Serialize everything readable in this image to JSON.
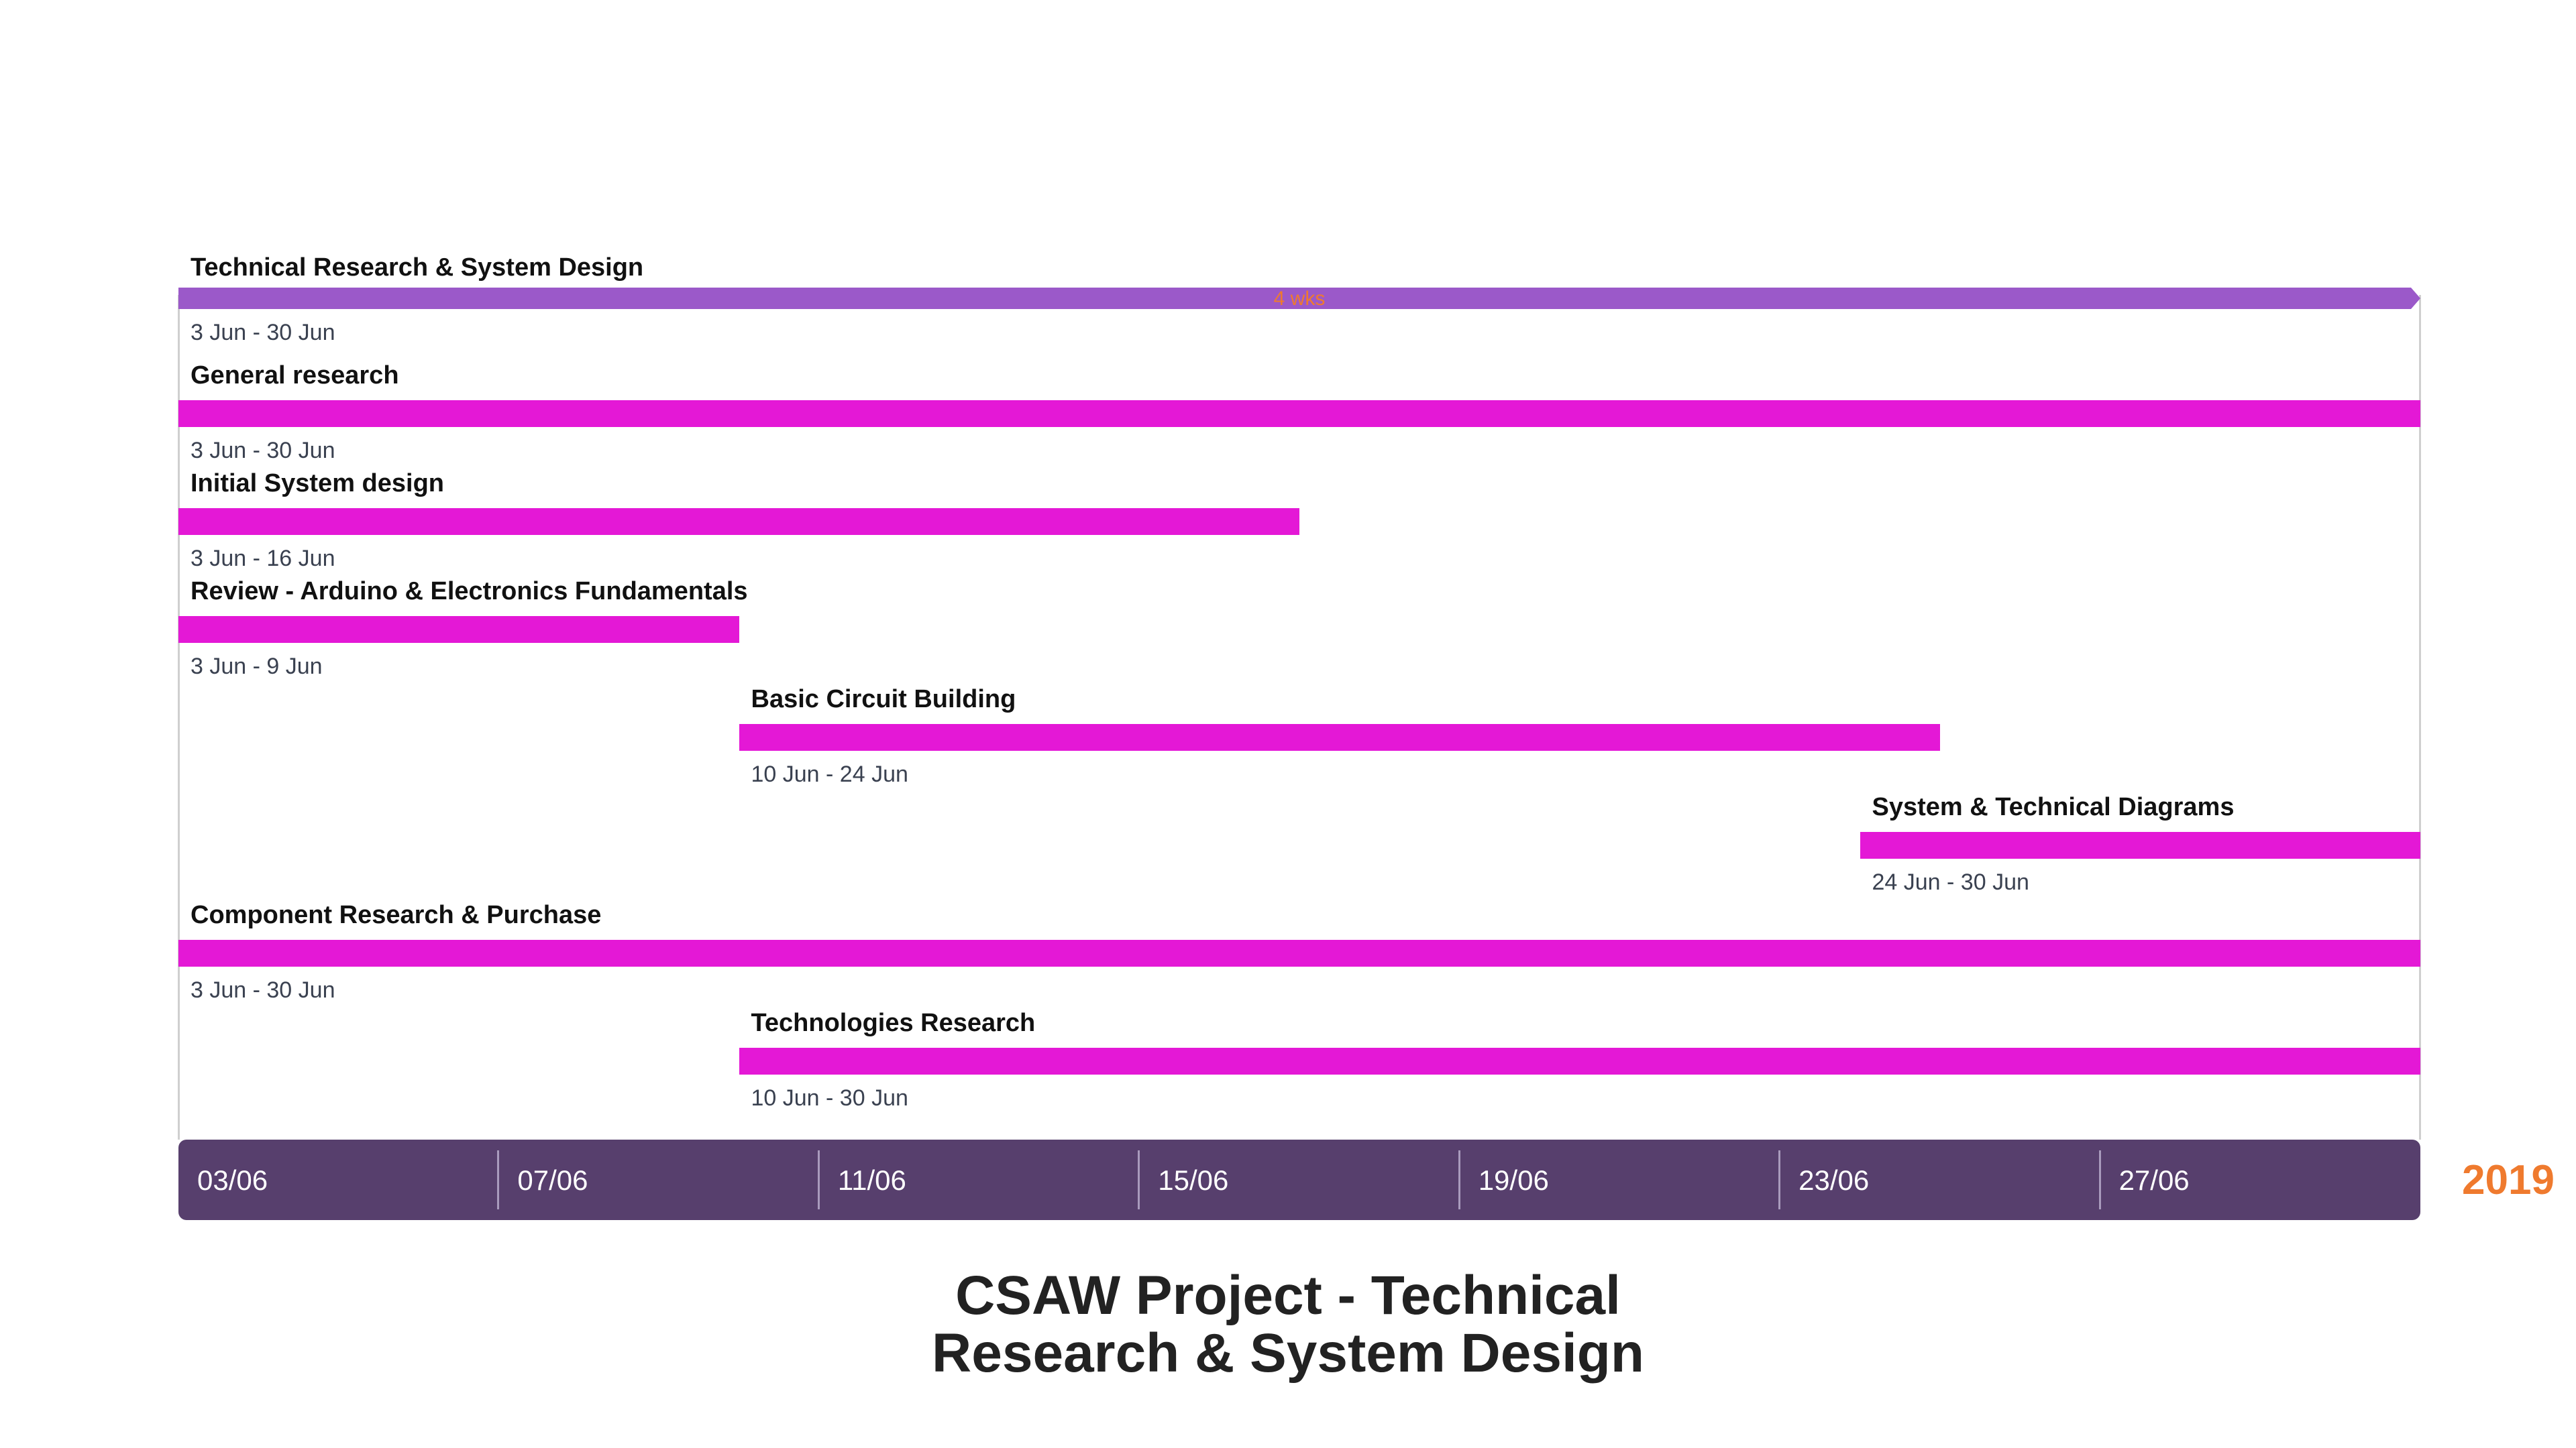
{
  "chart_data": {
    "type": "gantt",
    "title_lines": [
      "CSAW Project - Technical",
      "Research & System Design"
    ],
    "year": "2019",
    "x_range": [
      "2019-06-03",
      "2019-06-30"
    ],
    "ticks": [
      "03/06",
      "07/06",
      "11/06",
      "15/06",
      "19/06",
      "23/06",
      "27/06"
    ],
    "tick_dates": [
      "2019-06-03",
      "2019-06-07",
      "2019-06-11",
      "2019-06-15",
      "2019-06-19",
      "2019-06-23",
      "2019-06-27"
    ],
    "tasks": [
      {
        "name": "Technical Research & System Design",
        "dates": "3 Jun - 30 Jun",
        "start": "2019-06-03",
        "end": "2019-06-30",
        "kind": "summary",
        "duration_label": "4 wks"
      },
      {
        "name": "General research",
        "dates": "3 Jun - 30 Jun",
        "start": "2019-06-03",
        "end": "2019-06-30",
        "kind": "task"
      },
      {
        "name": "Initial System design",
        "dates": "3 Jun - 16 Jun",
        "start": "2019-06-03",
        "end": "2019-06-16",
        "kind": "task"
      },
      {
        "name": "Review - Arduino & Electronics Fundamentals",
        "dates": "3 Jun - 9 Jun",
        "start": "2019-06-03",
        "end": "2019-06-09",
        "kind": "task"
      },
      {
        "name": "Basic Circuit Building",
        "dates": "10 Jun - 24 Jun",
        "start": "2019-06-10",
        "end": "2019-06-24",
        "kind": "task"
      },
      {
        "name": "System & Technical Diagrams",
        "dates": "24 Jun - 30 Jun",
        "start": "2019-06-24",
        "end": "2019-06-30",
        "kind": "task"
      },
      {
        "name": "Component Research & Purchase",
        "dates": "3 Jun - 30 Jun",
        "start": "2019-06-03",
        "end": "2019-06-30",
        "kind": "task"
      },
      {
        "name": "Technologies Research",
        "dates": "10 Jun - 30 Jun",
        "start": "2019-06-10",
        "end": "2019-06-30",
        "kind": "task"
      }
    ]
  },
  "colors": {
    "summary_bar": "#9b59c9",
    "task_bar": "#e418d6",
    "axis_band": "#573f6d",
    "year": "#ef7a2e",
    "duration_text": "#ef7a2e"
  }
}
